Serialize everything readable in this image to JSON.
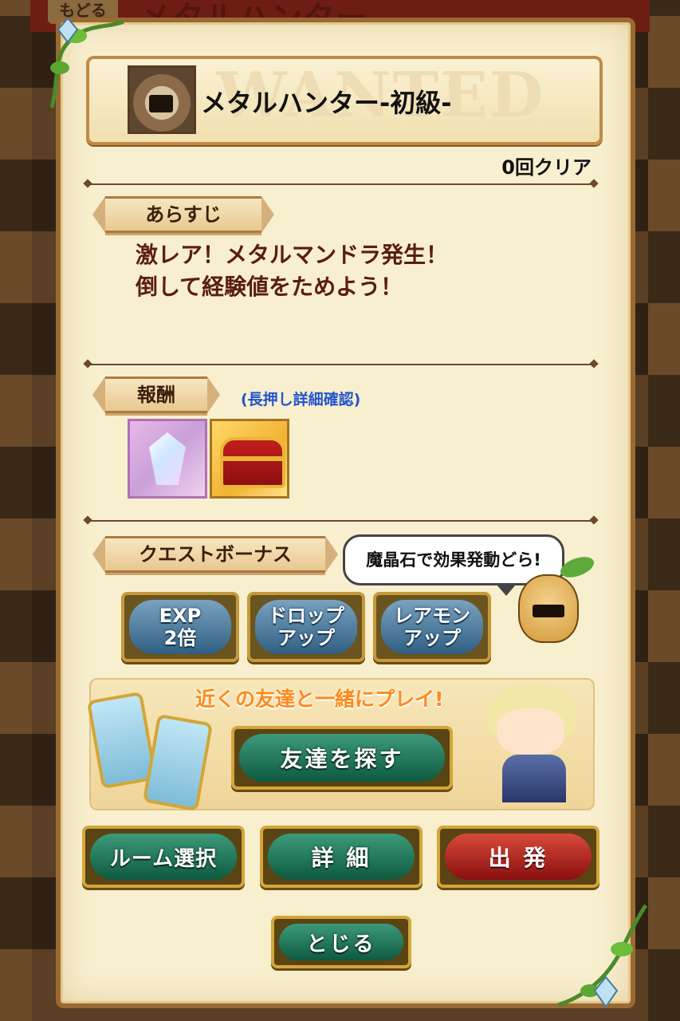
{
  "top": {
    "back_label": "もどる",
    "screen_title": "メタルハンター"
  },
  "quest": {
    "title": "メタルハンター-初級-",
    "watermark": "WANTED",
    "clear_count": "0回クリア"
  },
  "synopsis": {
    "heading": "あらすじ",
    "lines": [
      "激レア！メタルマンドラ発生！",
      "倒して経験値をためよう！"
    ]
  },
  "rewards": {
    "heading": "報酬",
    "hint": "(長押し詳細確認)",
    "items": [
      {
        "icon": "crystal-icon"
      },
      {
        "icon": "treasure-chest-icon"
      }
    ]
  },
  "bonus": {
    "heading": "クエストボーナス",
    "bubble": "魔晶石で効果発動どら!",
    "buttons": [
      "EXP\n2倍",
      "ドロップ\nアップ",
      "レアモン\nアップ"
    ]
  },
  "friend": {
    "banner": "近くの友達と一緒にプレイ!",
    "search_label": "友達を探す"
  },
  "actions": {
    "room_label": "ルーム選択",
    "details_label": "詳 細",
    "start_label": "出 発",
    "close_label": "とじる"
  },
  "colors": {
    "panel": "#f8efcf",
    "green_button": "#0e5a40",
    "red_button": "#8a0f0f",
    "bonus_button": "#2f5f82"
  }
}
